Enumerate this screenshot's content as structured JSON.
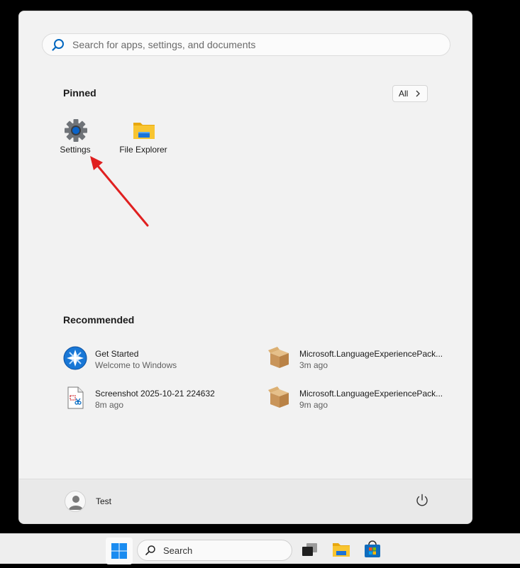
{
  "search": {
    "placeholder": "Search for apps, settings, and documents",
    "value": ""
  },
  "pinned": {
    "title": "Pinned",
    "all_label": "All",
    "apps": [
      {
        "label": "Settings",
        "icon": "gear-icon"
      },
      {
        "label": "File Explorer",
        "icon": "folder-icon"
      }
    ]
  },
  "recommended": {
    "title": "Recommended",
    "items": [
      {
        "title": "Get Started",
        "subtitle": "Welcome to Windows",
        "icon": "get-started-icon"
      },
      {
        "title": "Microsoft.LanguageExperiencePack...",
        "subtitle": "3m ago",
        "icon": "package-icon"
      },
      {
        "title": "Screenshot 2025-10-21 224632",
        "subtitle": "8m ago",
        "icon": "image-file-icon"
      },
      {
        "title": "Microsoft.LanguageExperiencePack...",
        "subtitle": "9m ago",
        "icon": "package-icon"
      }
    ]
  },
  "footer": {
    "user_name": "Test"
  },
  "taskbar": {
    "search_label": "Search"
  },
  "colors": {
    "accent": "#0067c0",
    "arrow": "#e02020",
    "folder": "#f8c531"
  }
}
